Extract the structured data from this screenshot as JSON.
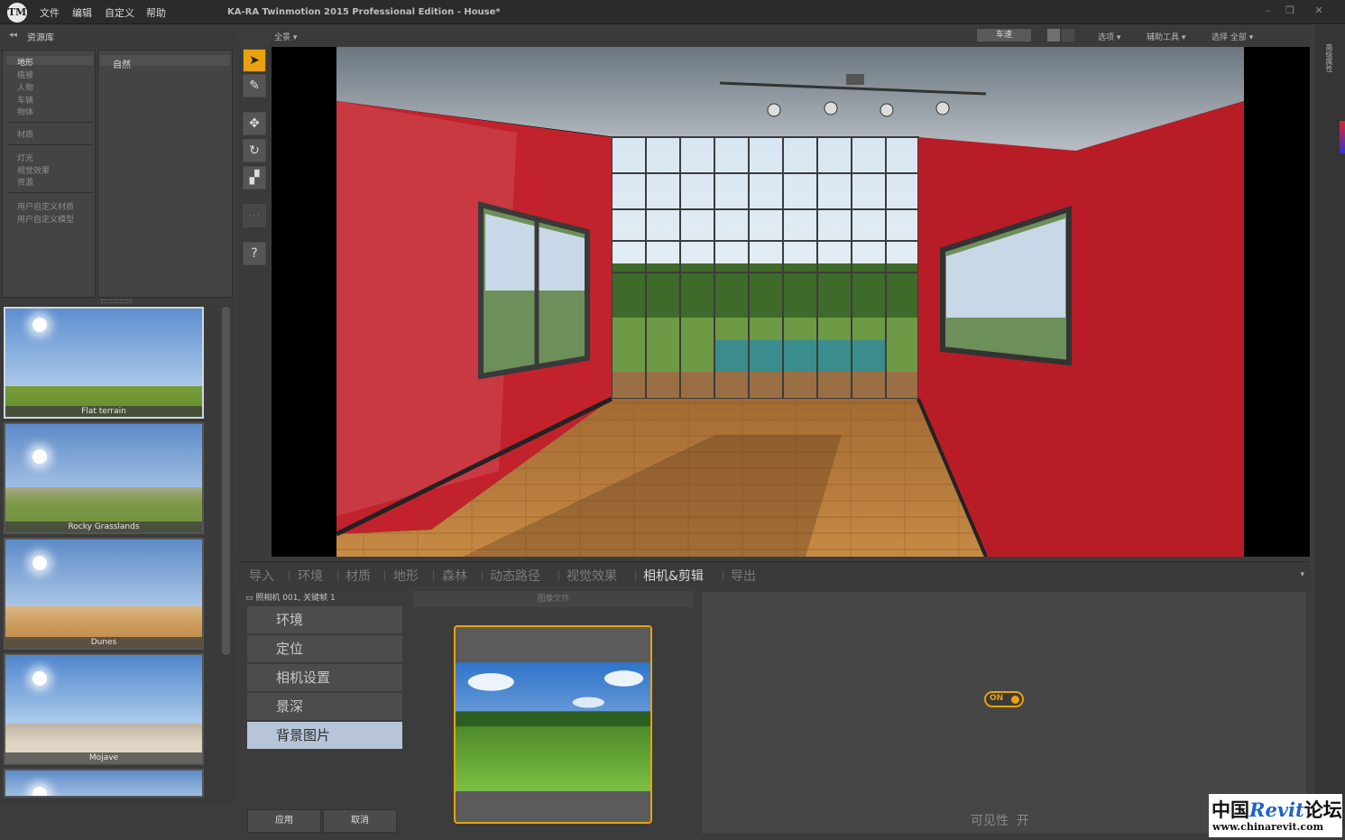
{
  "window": {
    "title": "KA-RA Twinmotion 2015 Professional Edition - House*",
    "logo": "TM"
  },
  "menu": {
    "file": "文件",
    "edit": "编辑",
    "custom": "自定义",
    "help": "帮助"
  },
  "library": {
    "header": "资源库",
    "categories": [
      "地形",
      "植被",
      "人物",
      "车辆",
      "物体",
      "材质",
      "灯光",
      "视觉效果",
      "资源",
      "用户自定义材质",
      "用户自定义模型"
    ],
    "subcategory": "自然",
    "thumbnails": [
      {
        "label": "Flat terrain"
      },
      {
        "label": "Rocky Grasslands"
      },
      {
        "label": "Dunes"
      },
      {
        "label": "Mojave"
      }
    ]
  },
  "viewport_bar": {
    "view_mode": "全景 ▾",
    "speed_label": "车速",
    "options": "选项 ▾",
    "helpers": "辅助工具 ▾",
    "select": "选择 全部 ▾"
  },
  "right_strip": {
    "label": "高级属性"
  },
  "tabs": [
    "导入",
    "环境",
    "材质",
    "地形",
    "森林",
    "动态路径",
    "视觉效果",
    "相机&剪辑",
    "导出"
  ],
  "active_tab": "相机&剪辑",
  "camera": {
    "label": "照相机 001, 关键帧 1",
    "menu": [
      "环境",
      "定位",
      "相机设置",
      "景深",
      "背景图片"
    ],
    "active_menu": "背景图片",
    "apply": "应用",
    "cancel": "取消"
  },
  "background_panel": {
    "header": "图像文件",
    "toggle_label": "ON",
    "visibility_label": "可见性",
    "visibility_value": "开"
  },
  "watermark": {
    "title_cn": "中国",
    "title_rv": "Revit",
    "title_end": "论坛",
    "url": "www.chinarevit.com"
  },
  "colors": {
    "accent": "#e8a20d",
    "selected_menu": "#b6c5d8",
    "wall_red": "#c8232d"
  }
}
